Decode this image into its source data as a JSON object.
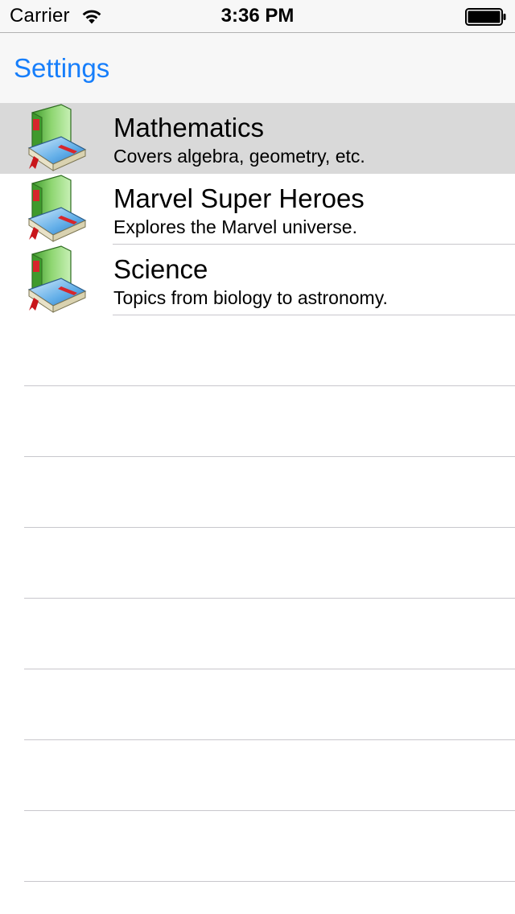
{
  "status_bar": {
    "carrier": "Carrier",
    "time": "3:36 PM",
    "wifi_icon": "wifi-icon",
    "battery_icon": "battery-full-icon"
  },
  "nav_bar": {
    "back_label": "Settings"
  },
  "colors": {
    "accent": "#167efb",
    "selected_row": "#d9d9d9",
    "separator": "#c8c7cc",
    "bar_background": "#f7f7f7"
  },
  "table": {
    "rows": [
      {
        "title": "Mathematics",
        "subtitle": "Covers algebra, geometry, etc.",
        "icon": "book-icon",
        "selected": true
      },
      {
        "title": "Marvel Super Heroes",
        "subtitle": "Explores the Marvel universe.",
        "icon": "book-icon",
        "selected": false
      },
      {
        "title": "Science",
        "subtitle": "Topics from biology to astronomy.",
        "icon": "book-icon",
        "selected": false
      }
    ]
  }
}
